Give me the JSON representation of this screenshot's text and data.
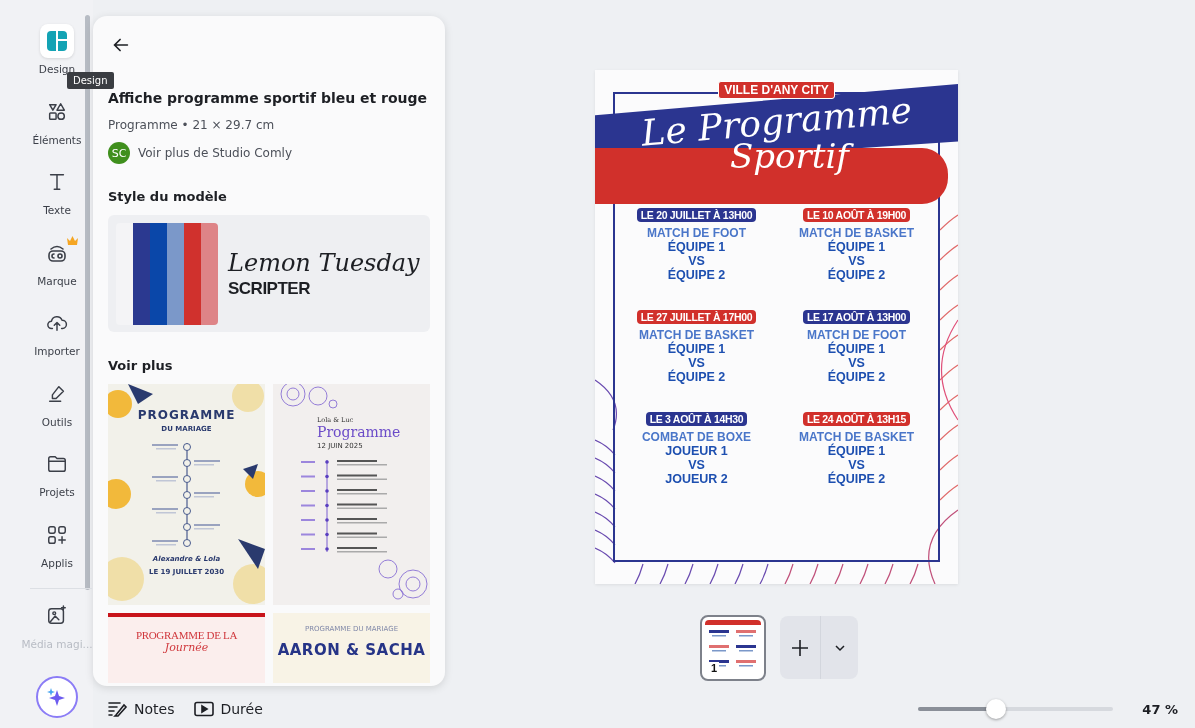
{
  "sidebar": {
    "items": [
      {
        "label": "Design",
        "kind": "design",
        "selected": true,
        "disabled": false
      },
      {
        "label": "Éléments",
        "kind": "elements",
        "selected": false,
        "disabled": false
      },
      {
        "label": "Texte",
        "kind": "text",
        "selected": false,
        "disabled": false
      },
      {
        "label": "Marque",
        "kind": "brand",
        "selected": false,
        "disabled": false
      },
      {
        "label": "Importer",
        "kind": "upload",
        "selected": false,
        "disabled": false
      },
      {
        "label": "Outils",
        "kind": "tools",
        "selected": false,
        "disabled": false
      },
      {
        "label": "Projets",
        "kind": "projects",
        "selected": false,
        "disabled": false
      },
      {
        "label": "Applis",
        "kind": "apps",
        "selected": false,
        "disabled": false
      },
      {
        "label": "Média magi...",
        "kind": "magic-media",
        "selected": false,
        "disabled": true
      }
    ],
    "tooltip": "Design"
  },
  "panel": {
    "title": "Affiche programme sportif bleu et rouge",
    "meta": "Programme • 21 × 29.7 cm",
    "author": {
      "initials": "SC",
      "link": "Voir plus de Studio Comly"
    },
    "style_heading": "Style du modèle",
    "style": {
      "palette": [
        {
          "color": "#f4f4f6"
        },
        {
          "color": "#2b3990"
        },
        {
          "color": "#0a47a9"
        },
        {
          "color": "#7b98c9"
        },
        {
          "color": "#d0312d"
        },
        {
          "color": "#de8487"
        }
      ],
      "font_primary": "Lemon Tuesday",
      "font_secondary": "SCRIPTER"
    },
    "more_heading": "Voir plus",
    "templates": [
      {
        "kind": "floral-yellow",
        "texts": [
          "PROGRAMME",
          "DU MARIAGE",
          "Alexandre & Lola",
          "LE 19 JUILLET 2030"
        ]
      },
      {
        "kind": "floral-purple",
        "texts": [
          "Lola & Luc",
          "Programme",
          "12 JUIN 2025"
        ]
      },
      {
        "kind": "red-header",
        "texts": [
          "PROGRAMME DE LA",
          "Journée"
        ]
      },
      {
        "kind": "cream",
        "texts": [
          "PROGRAMME DU MARIAGE",
          "AARON & SACHA"
        ]
      }
    ]
  },
  "footer": {
    "notes": "Notes",
    "duration": "Durée"
  },
  "poster": {
    "city": "VILLE D'ANY CITY",
    "title": "Le Programme",
    "subtitle": "Sportif",
    "events": [
      {
        "date": "LE 20 JUILLET À 13H00",
        "color": "#2b3590",
        "event": "MATCH DE FOOT",
        "team_1": "ÉQUIPE 1",
        "vs": "VS",
        "team_2": "ÉQUIPE 2"
      },
      {
        "date": "LE 10 AOÛT À 19H00",
        "color": "#d1302b",
        "event": "MATCH DE BASKET",
        "team_1": "ÉQUIPE 1",
        "vs": "VS",
        "team_2": "ÉQUIPE 2"
      },
      {
        "date": "LE 27 JUILLET À 17H00",
        "color": "#d1302b",
        "event": "MATCH DE BASKET",
        "team_1": "ÉQUIPE 1",
        "vs": "VS",
        "team_2": "ÉQUIPE 2"
      },
      {
        "date": "LE 17 AOÛT À 13H00",
        "color": "#2b3590",
        "event": "MATCH DE FOOT",
        "team_1": "ÉQUIPE 1",
        "vs": "VS",
        "team_2": "ÉQUIPE 2"
      },
      {
        "date": "LE 3 AOÛT À 14H30",
        "color": "#2b3590",
        "event": "COMBAT DE BOXE",
        "team_1": "JOUEUR 1",
        "vs": "VS",
        "team_2": "JOUEUR 2"
      },
      {
        "date": "LE 24 AOÛT À 13H15",
        "color": "#d1302b",
        "event": "MATCH DE BASKET",
        "team_1": "ÉQUIPE 1",
        "vs": "VS",
        "team_2": "ÉQUIPE 2"
      }
    ]
  },
  "pages": [
    {
      "number": "1",
      "selected": true
    }
  ],
  "zoom": {
    "level": 0.4,
    "reading": "47 %"
  }
}
